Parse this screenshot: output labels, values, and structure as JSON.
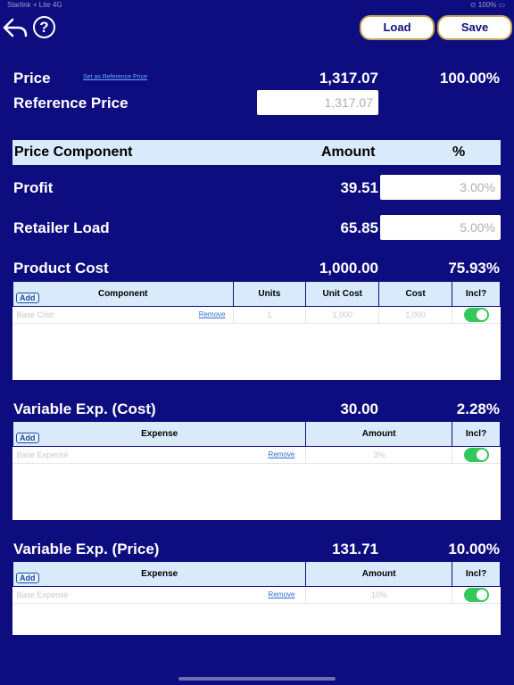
{
  "status": {
    "left": "Starlink + Lite 4G",
    "right": "⊙ 100% ▭"
  },
  "toolbar": {
    "load": "Load",
    "save": "Save",
    "help": "?"
  },
  "price": {
    "label": "Price",
    "link": "Set as Reference Price",
    "amount": "1,317.07",
    "percent": "100.00%"
  },
  "reference": {
    "label": "Reference Price",
    "value": "1,317.07"
  },
  "component_header": {
    "label": "Price Component",
    "amount": "Amount",
    "percent": "%"
  },
  "profit": {
    "label": "Profit",
    "amount": "39.51",
    "percent": "3.00%"
  },
  "retailer": {
    "label": "Retailer Load",
    "amount": "65.85",
    "percent": "5.00%"
  },
  "product": {
    "label": "Product Cost",
    "amount": "1,000.00",
    "percent": "75.93%",
    "add": "Add",
    "cols": [
      "Component",
      "Units",
      "Unit Cost",
      "Cost",
      "Incl?"
    ],
    "rows": [
      {
        "name": "Base Cost",
        "remove": "Remove",
        "units": "1",
        "unit_cost": "1,000",
        "cost": "1,000"
      }
    ]
  },
  "varcost": {
    "label": "Variable Exp. (Cost)",
    "amount": "30.00",
    "percent": "2.28%",
    "add": "Add",
    "cols": [
      "Expense",
      "Amount",
      "Incl?"
    ],
    "rows": [
      {
        "name": "Base Expense",
        "remove": "Remove",
        "amount": "3%"
      }
    ]
  },
  "varprice": {
    "label": "Variable Exp. (Price)",
    "amount": "131.71",
    "percent": "10.00%",
    "add": "Add",
    "cols": [
      "Expense",
      "Amount",
      "Incl?"
    ],
    "rows": [
      {
        "name": "Base Expense",
        "remove": "Remove",
        "amount": "10%"
      }
    ]
  }
}
